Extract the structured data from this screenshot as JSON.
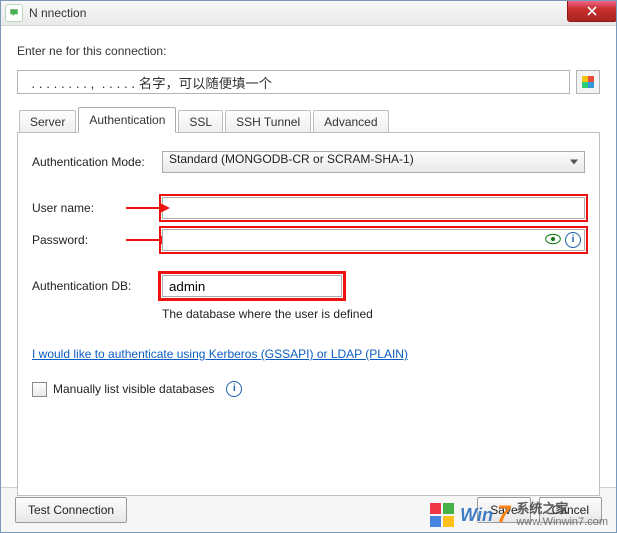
{
  "titlebar": {
    "title": "N          nnection"
  },
  "header": {
    "prompt": "Enter        ne for this connection:",
    "name_value": "  . . . . . . . . ,  . . . . . 名字，可以随便填一个"
  },
  "tabs": [
    "Server",
    "Authentication",
    "SSL",
    "SSH Tunnel",
    "Advanced"
  ],
  "active_tab_index": 1,
  "auth": {
    "mode_label": "Authentication Mode:",
    "mode_value": "Standard (MONGODB-CR or SCRAM-SHA-1)",
    "user_label": "User name:",
    "user_value": "",
    "password_label": "Password:",
    "password_value": "",
    "db_label": "Authentication DB:",
    "db_value": "admin",
    "db_hint": "The database where the user is defined",
    "link_text": "I would like to authenticate using Kerberos (GSSAPI) or LDAP (PLAIN)",
    "checkbox_label": "Manually list visible databases"
  },
  "footer": {
    "test": "Test Connection",
    "save": "Save",
    "cancel": "Cancel"
  },
  "watermark": {
    "brand": "Win",
    "seven": "7",
    "cn": "系统之家",
    "url": "www.Winwin7.com"
  },
  "icons": {
    "app": "speech-bubble-icon",
    "close": "close-icon",
    "color_picker": "color-swatch-icon",
    "dropdown": "chevron-down-icon",
    "arrow": "red-arrow-icon",
    "eye": "eye-icon",
    "info": "info-icon"
  },
  "colors": {
    "highlight": "#e11",
    "link": "#0b5dc2"
  }
}
